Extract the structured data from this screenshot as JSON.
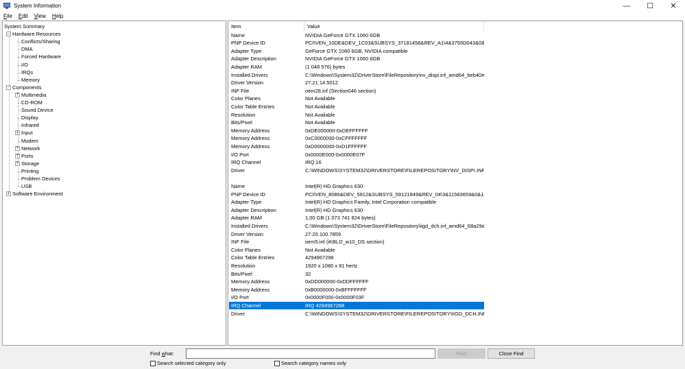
{
  "window": {
    "title": "System Information",
    "controls": {
      "minimize": "—",
      "maximize": "☐",
      "close": "✕"
    }
  },
  "menu": [
    {
      "label": "File",
      "accel": "F",
      "rest": "ile"
    },
    {
      "label": "Edit",
      "accel": "E",
      "rest": "dit"
    },
    {
      "label": "View",
      "accel": "V",
      "rest": "iew"
    },
    {
      "label": "Help",
      "accel": "H",
      "rest": "elp"
    }
  ],
  "tree": [
    {
      "label": "System Summary",
      "depth": 0,
      "expander": ""
    },
    {
      "label": "Hardware Resources",
      "depth": 1,
      "expander": "−"
    },
    {
      "label": "Conflicts/Sharing",
      "depth": 2,
      "expander": ""
    },
    {
      "label": "DMA",
      "depth": 2,
      "expander": ""
    },
    {
      "label": "Forced Hardware",
      "depth": 2,
      "expander": ""
    },
    {
      "label": "I/O",
      "depth": 2,
      "expander": ""
    },
    {
      "label": "IRQs",
      "depth": 2,
      "expander": ""
    },
    {
      "label": "Memory",
      "depth": 2,
      "expander": ""
    },
    {
      "label": "Components",
      "depth": 1,
      "expander": "−"
    },
    {
      "label": "Multimedia",
      "depth": 2,
      "expander": "+"
    },
    {
      "label": "CD-ROM",
      "depth": 2,
      "expander": ""
    },
    {
      "label": "Sound Device",
      "depth": 2,
      "expander": ""
    },
    {
      "label": "Display",
      "depth": 2,
      "expander": ""
    },
    {
      "label": "Infrared",
      "depth": 2,
      "expander": ""
    },
    {
      "label": "Input",
      "depth": 2,
      "expander": "+"
    },
    {
      "label": "Modem",
      "depth": 2,
      "expander": ""
    },
    {
      "label": "Network",
      "depth": 2,
      "expander": "+"
    },
    {
      "label": "Ports",
      "depth": 2,
      "expander": "+"
    },
    {
      "label": "Storage",
      "depth": 2,
      "expander": "+"
    },
    {
      "label": "Printing",
      "depth": 2,
      "expander": ""
    },
    {
      "label": "Problem Devices",
      "depth": 2,
      "expander": ""
    },
    {
      "label": "USB",
      "depth": 2,
      "expander": ""
    },
    {
      "label": "Software Environment",
      "depth": 1,
      "expander": "+"
    }
  ],
  "list": {
    "columns": [
      "Item",
      "Value"
    ],
    "rows": [
      [
        "Name",
        "NVIDIA GeForce GTX 1060 6GB"
      ],
      [
        "PNP Device ID",
        "PCI\\VEN_10DE&DEV_1C03&SUBSYS_37181458&REV_A1\\4&3755D043&0&0008"
      ],
      [
        "Adapter Type",
        "GeForce GTX 1060 6GB, NVIDIA compatible"
      ],
      [
        "Adapter Description",
        "NVIDIA GeForce GTX 1060 6GB"
      ],
      [
        "Adapter RAM",
        "(1 048 576) bytes"
      ],
      [
        "Installed Drivers",
        "C:\\Windows\\System32\\DriverStore\\FileRepository\\nv_dispi.inf_amd64_beb40e..."
      ],
      [
        "Driver Version",
        "27.21.14.5012"
      ],
      [
        "INF File",
        "oem28.inf (Section046 section)"
      ],
      [
        "Color Planes",
        "Not Available"
      ],
      [
        "Color Table Entries",
        "Not Available"
      ],
      [
        "Resolution",
        "Not Available"
      ],
      [
        "Bits/Pixel",
        "Not Available"
      ],
      [
        "Memory Address",
        "0xDE000000-0xDEFFFFFF"
      ],
      [
        "Memory Address",
        "0xC0000000-0xCFFFFFFF"
      ],
      [
        "Memory Address",
        "0xD0000000-0xD1FFFFFF"
      ],
      [
        "I/O Port",
        "0x0000E000-0x0000E07F"
      ],
      [
        "IRQ Channel",
        "IRQ 16"
      ],
      [
        "Driver",
        "C:\\WINDOWS\\SYSTEM32\\DRIVERSTORE\\FILEREPOSITORY\\NV_DISPI.INF_AMD6..."
      ],
      [
        "",
        ""
      ],
      [
        "Name",
        "Intel(R) HD Graphics 630"
      ],
      [
        "PNP Device ID",
        "PCI\\VEN_8086&DEV_5912&SUBSYS_59121849&REV_04\\3&11583659&0&10"
      ],
      [
        "Adapter Type",
        "Intel(R) HD Graphics Family, Intel Corporation compatible"
      ],
      [
        "Adapter Description",
        "Intel(R) HD Graphics 630"
      ],
      [
        "Adapter RAM",
        "1,00 GB (1 073 741 824 bytes)"
      ],
      [
        "Installed Drivers",
        "C:\\Windows\\System32\\DriverStore\\FileRepository\\iigd_dch.inf_amd64_68a29d..."
      ],
      [
        "Driver Version",
        "27.20.100.7859"
      ],
      [
        "INF File",
        "oem5.inf (iKBLD_w10_DS section)"
      ],
      [
        "Color Planes",
        "Not Available"
      ],
      [
        "Color Table Entries",
        "4294967296"
      ],
      [
        "Resolution",
        "1920 x 1080 x 81 hertz"
      ],
      [
        "Bits/Pixel",
        "32"
      ],
      [
        "Memory Address",
        "0xDD000000-0xDDFFFFFF"
      ],
      [
        "Memory Address",
        "0xB0000000-0xBFFFFFFF"
      ],
      [
        "I/O Port",
        "0x0000F000-0x0000F03F"
      ],
      [
        "IRQ Channel",
        "IRQ 4294967288"
      ],
      [
        "Driver",
        "C:\\WINDOWS\\SYSTEM32\\DRIVERSTORE\\FILEREPOSITORY\\IIGD_DCH.INF_AMD6..."
      ]
    ],
    "selected_row": 34
  },
  "find": {
    "label_pre": "Find ",
    "label_accel": "w",
    "label_post": "hat:",
    "input_value": "",
    "find_button": "Find",
    "close_find_button": "Close Find",
    "search_selected_label": "Search selected category only",
    "search_names_label": "Search category names only"
  },
  "colors": {
    "selection": "#0078d7"
  }
}
